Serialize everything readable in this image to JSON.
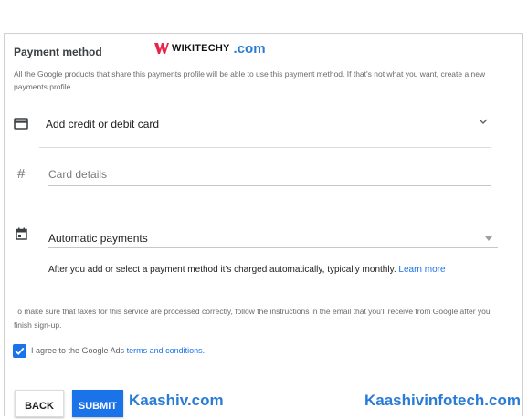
{
  "header": {
    "title": "Payment method",
    "logo_brand": "WIKITECHY",
    "logo_suffix": ".com",
    "description": "All the Google products that share this payments profile will be able to use this payment method. If that's not what you want, create a new payments profile."
  },
  "card_option": {
    "label": "Add credit or debit card",
    "icon": "credit-card-icon",
    "expand_icon": "chevron-down-icon"
  },
  "card_details": {
    "placeholder": "Card details",
    "icon": "hash-icon"
  },
  "payments": {
    "selected_value": "Automatic payments",
    "icon": "calendar-icon",
    "note": "After you add or select a payment method it's charged automatically, typically monthly.",
    "learn_more": "Learn more"
  },
  "tax_note": "To make sure that taxes for this service are processed correctly, follow the instructions in the email that you'll receive from Google after you finish sign-up.",
  "terms": {
    "checked": true,
    "prefix": "I agree to the Google Ads",
    "link": "terms and conditions."
  },
  "buttons": {
    "back": "BACK",
    "submit": "SUBMIT"
  },
  "watermarks": {
    "left": "Kaashiv.com",
    "right": "Kaashivinfotech.com"
  },
  "colors": {
    "accent": "#1a73e8",
    "watermark": "#2a7bd5",
    "logo_mark": "#e8244b"
  }
}
